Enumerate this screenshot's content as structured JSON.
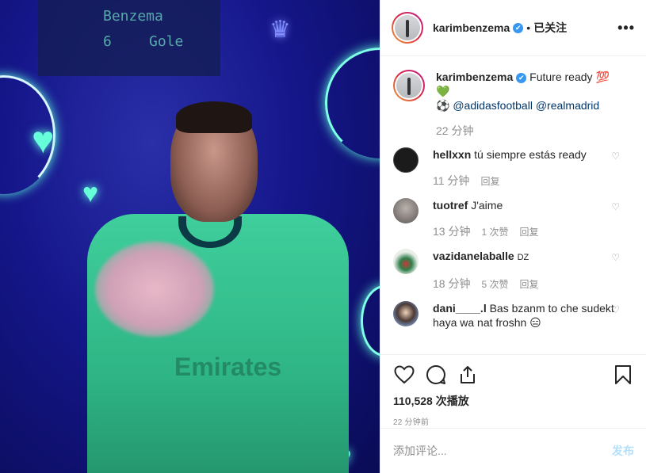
{
  "header": {
    "username": "karimbenzema",
    "verified_icon": "✔",
    "separator": "•",
    "follow_status": "已关注",
    "more_label": "•••"
  },
  "media": {
    "scoreboard_line1": "Benzema",
    "scoreboard_line2_num": "6",
    "scoreboard_line2_word": "Gole",
    "jersey_text": "Emirates"
  },
  "caption": {
    "username": "karimbenzema",
    "text": "Future ready",
    "emoji_hundred": "💯",
    "emoji_heart": "💚",
    "emoji_ball": "⚽",
    "mention1": "@adidasfootball",
    "mention2": "@realmadrid",
    "time": "22 分钟"
  },
  "comments": [
    {
      "username": "hellxxn",
      "text": "tú siempre estás ready",
      "time": "11 分钟",
      "likes": "",
      "reply": "回复",
      "avatar_color": "#1b1b1b"
    },
    {
      "username": "tuotref",
      "text": "J'aime",
      "time": "13 分钟",
      "likes": "1 次赞",
      "reply": "回复",
      "avatar_color": "#8a8380"
    },
    {
      "username": "vazidanelaballe",
      "text": "DZ",
      "time": "18 分钟",
      "likes": "5 次赞",
      "reply": "回复",
      "avatar_color": "#dfe6e0"
    },
    {
      "username": "dani____.l",
      "text": "Bas bzanm to che sudekt haya wa nat froshn 😑",
      "time": "",
      "likes": "",
      "reply": "",
      "avatar_color": "#6d7fa0"
    }
  ],
  "actions": {
    "views": "110,528 次播放",
    "posted": "22 分钟前"
  },
  "add_comment": {
    "placeholder": "添加评论...",
    "post_label": "发布"
  }
}
